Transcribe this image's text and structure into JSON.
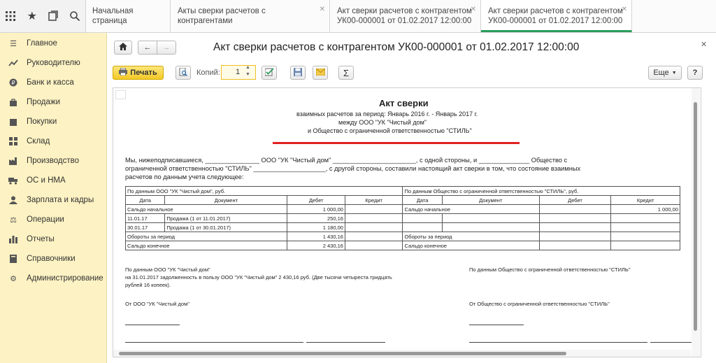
{
  "tabs": [
    {
      "line1": "Начальная страница",
      "line2": ""
    },
    {
      "line1": "Акты сверки расчетов с контрагентами",
      "line2": ""
    },
    {
      "line1": "Акт сверки расчетов с контрагентом",
      "line2": "УК00-000001 от 01.02.2017 12:00:00"
    },
    {
      "line1": "Акт сверки расчетов с контрагентом",
      "line2": "УК00-000001 от 01.02.2017 12:00:00"
    }
  ],
  "sidebar": {
    "items": [
      {
        "label": "Главное",
        "icon": "menu-icon"
      },
      {
        "label": "Руководителю",
        "icon": "chart-line-icon"
      },
      {
        "label": "Банк и касса",
        "icon": "coin-icon"
      },
      {
        "label": "Продажи",
        "icon": "bag-icon"
      },
      {
        "label": "Покупки",
        "icon": "cart-icon"
      },
      {
        "label": "Склад",
        "icon": "warehouse-icon"
      },
      {
        "label": "Производство",
        "icon": "factory-icon"
      },
      {
        "label": "ОС и НМА",
        "icon": "truck-icon"
      },
      {
        "label": "Зарплата и кадры",
        "icon": "people-icon"
      },
      {
        "label": "Операции",
        "icon": "operations-icon"
      },
      {
        "label": "Отчеты",
        "icon": "bar-chart-icon"
      },
      {
        "label": "Справочники",
        "icon": "book-icon"
      },
      {
        "label": "Администрирование",
        "icon": "gear-icon"
      }
    ]
  },
  "form": {
    "title": "Акт сверки расчетов с контрагентом УК00-000001 от 01.02.2017 12:00:00",
    "print_label": "Печать",
    "copies_label": "Копий:",
    "copies_value": "1",
    "more_label": "Еще",
    "help_label": "?",
    "sum_label": "Σ"
  },
  "doc": {
    "heading": "Акт сверки",
    "sub1": "взаимных расчетов за период: Январь 2016 г. - Январь 2017 г.",
    "sub2": "между ООО \"УК \"Чистый дом\"",
    "sub3": "и Общество с ограниченной ответственностью \"СТИЛЬ\"",
    "para1": "Мы, нижеподписавшиеся, _______________ ООО \"УК \"Чистый дом\" _______________________, с одной стороны, и ______________ Общество с",
    "para2": "ограниченной ответственностью \"СТИЛЬ\" ____________________, с другой стороны, составили настоящий акт сверки в том, что состояние взаимных",
    "para3": "расчетов по данным учета следующее:",
    "left_header": "По данным ООО \"УК \"Чистый дом\", руб.",
    "right_header": "По данным Общество с ограниченной ответственностью \"СТИЛЬ\", руб.",
    "cols": [
      "Дата",
      "Документ",
      "Дебет",
      "Кредит",
      "Дата",
      "Документ",
      "Дебет",
      "Кредит"
    ],
    "rows": [
      {
        "ld": "Сальдо начальное",
        "ldoc": "",
        "ldeb": "1 000,00",
        "lcr": "",
        "rd": "Сальдо начальное",
        "rdoc": "",
        "rdeb": "",
        "rcr": "1 000,00"
      },
      {
        "ld": "11.01.17",
        "ldoc": "Продажа (1 от 11.01.2017)",
        "ldeb": "250,16",
        "lcr": "",
        "rd": "",
        "rdoc": "",
        "rdeb": "",
        "rcr": ""
      },
      {
        "ld": "30.01.17",
        "ldoc": "Продажа (1 от 30.01.2017)",
        "ldeb": "1 180,00",
        "lcr": "",
        "rd": "",
        "rdoc": "",
        "rdeb": "",
        "rcr": ""
      },
      {
        "ld": "Обороты за период",
        "ldoc": "",
        "ldeb": "1 430,16",
        "lcr": "",
        "rd": "Обороты за период",
        "rdoc": "",
        "rdeb": "",
        "rcr": ""
      },
      {
        "ld": "Сальдо конечное",
        "ldoc": "",
        "ldeb": "2 430,16",
        "lcr": "",
        "rd": "Сальдо конечное",
        "rdoc": "",
        "rdeb": "",
        "rcr": ""
      }
    ],
    "foot_left1": "По данным ООО \"УК \"Чистый дом\"",
    "foot_left2": "на 31.01.2017 задолженность в пользу ООО \"УК \"Чистый дом\" 2 430,16 руб. (Две тысячи четыреста тридцать",
    "foot_left3": "рублей 16 копеек).",
    "foot_right1": "По данным Общество с ограниченной ответственностью \"СТИЛЬ\"",
    "from_left": "От ООО \"УК \"Чистый дом\"",
    "from_right": "От Общество с ограниченной ответственностью \"СТИЛЬ\""
  },
  "colors": {
    "accent": "#2a9d5c",
    "sidebar": "#fdf2c3",
    "print_button": "#f7d44a",
    "underline": "#e02020"
  }
}
